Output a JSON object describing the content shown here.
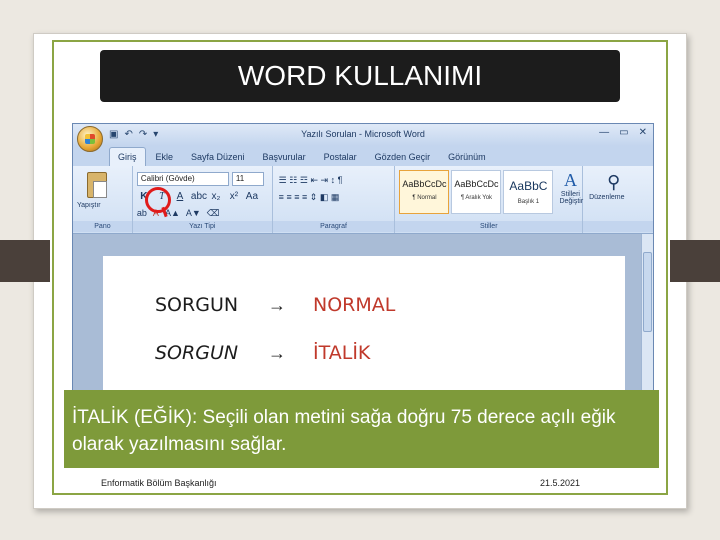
{
  "slide": {
    "title": "WORD KULLANIMI",
    "caption": "İTALİK (EĞİK): Seçili olan metini sağa doğru 75 derece açılı eğik olarak yazılmasını sağlar.",
    "footer_left": "Enformatik Bölüm Başkanlığı",
    "footer_right": "21.5.2021"
  },
  "word": {
    "window_title": "Yazılı Sorulan - Microsoft Word",
    "tabs": [
      "Giriş",
      "Ekle",
      "Sayfa Düzeni",
      "Başvurular",
      "Postalar",
      "Gözden Geçir",
      "Görünüm"
    ],
    "ribbon": {
      "paste_label": "Yapıştır",
      "font_name": "Calibri (Gövde)",
      "font_size": "11",
      "group_labels": [
        "Pano",
        "Yazı Tipi",
        "Paragraf",
        "Stiller",
        ""
      ],
      "styles": [
        {
          "sample": "AaBbCcDc",
          "name": "¶ Normal"
        },
        {
          "sample": "AaBbCcDc",
          "name": "¶ Aralık Yok"
        },
        {
          "sample": "AaBbC",
          "name": "Başlık 1"
        }
      ],
      "change_styles_label": "Stilleri Değiştir",
      "edit_label": "Düzenleme"
    },
    "document": {
      "line1_text": "SORGUN",
      "line1_result": "NORMAL",
      "line2_text": "SORGUN",
      "line2_result": "İTALİK",
      "arrow": "→"
    }
  },
  "colors": {
    "accent_green": "#7e9a3a",
    "highlight_red": "#e01b1b",
    "title_bg": "#1c1c1c"
  }
}
